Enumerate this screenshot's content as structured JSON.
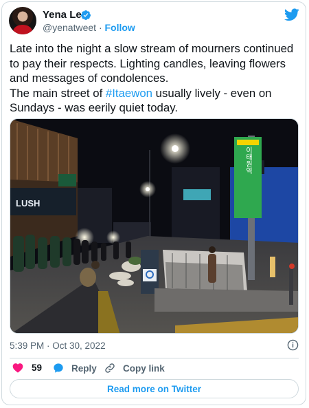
{
  "author": {
    "name": "Yena Lee",
    "handle": "@yenatweet",
    "separator": "·",
    "follow_label": "Follow"
  },
  "tweet": {
    "text_before": "Late into the night a slow stream of mourners continued to pay their respects. Lighting candles, leaving flowers and messages of condolences.\nThe main street of ",
    "hashtag": "#Itaewon",
    "text_after": " usually lively - even on Sundays - was eerily quiet today."
  },
  "photo": {
    "sign_vertical_text": "이태원역"
  },
  "meta": {
    "timestamp": "5:39 PM · Oct 30, 2022"
  },
  "actions": {
    "like_count": "59",
    "reply_label": "Reply",
    "copy_link_label": "Copy link"
  },
  "footer": {
    "read_more_label": "Read more on Twitter"
  },
  "colors": {
    "accent": "#1d9bf0",
    "like": "#f91880",
    "muted": "#536471",
    "text": "#0f1419",
    "border": "#cfd9de"
  },
  "icons": [
    "verified-badge-icon",
    "twitter-bird-icon",
    "info-icon",
    "heart-icon",
    "reply-bubble-icon",
    "link-icon"
  ]
}
